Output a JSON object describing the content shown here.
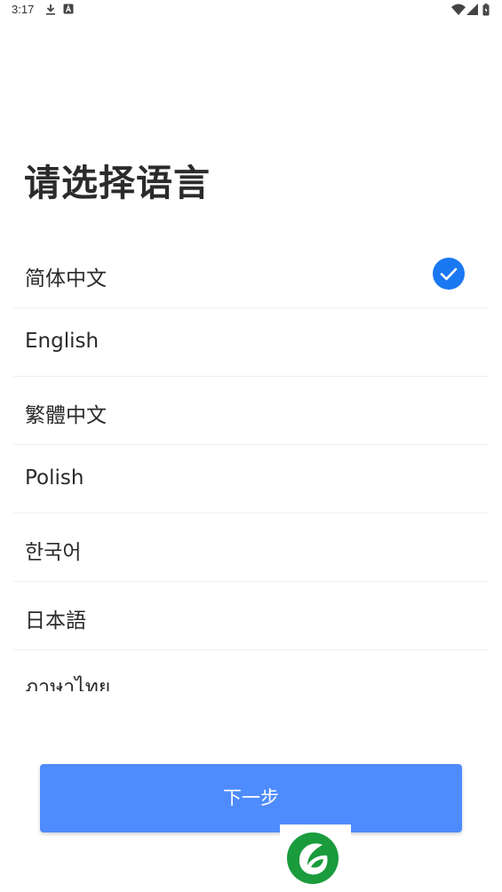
{
  "status_bar": {
    "time": "3:17",
    "left_icons": [
      "download-icon",
      "font-icon"
    ],
    "right_icons": [
      "wifi-icon",
      "signal-icon",
      "battery-icon"
    ]
  },
  "title": "请选择语言",
  "languages": [
    {
      "label": "简体中文",
      "selected": true
    },
    {
      "label": "English",
      "selected": false
    },
    {
      "label": "繁體中文",
      "selected": false
    },
    {
      "label": "Polish",
      "selected": false
    },
    {
      "label": "한국어",
      "selected": false
    },
    {
      "label": "日本語",
      "selected": false
    },
    {
      "label": "ภาษาไทย",
      "selected": false
    }
  ],
  "next_button_label": "下一步",
  "colors": {
    "accent": "#4e8bfd",
    "check": "#1a78f2",
    "logo_green": "#1a9b3c"
  }
}
